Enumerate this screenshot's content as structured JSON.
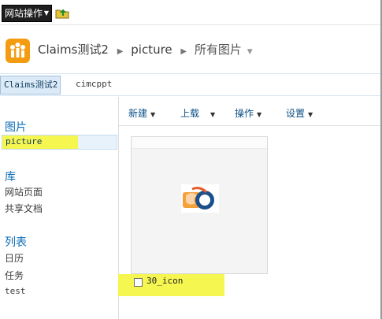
{
  "topbar": {
    "site_actions_label": "网站操作",
    "nav_up_icon": "folder-up-icon"
  },
  "header": {
    "logo_icon": "people-logo-icon",
    "breadcrumb": {
      "site": "Claims测试2",
      "library": "picture",
      "view": "所有图片"
    }
  },
  "top_nav": {
    "tabs": [
      {
        "label": "Claims测试2",
        "selected": true
      },
      {
        "label": "cimcppt",
        "selected": false
      }
    ]
  },
  "quick_launch": {
    "sections": [
      {
        "heading": "图片",
        "items": [
          "picture"
        ]
      },
      {
        "heading": "库",
        "items": [
          "网站页面",
          "共享文档"
        ]
      },
      {
        "heading": "列表",
        "items": [
          "日历",
          "任务",
          "test"
        ]
      }
    ]
  },
  "toolbar": {
    "new_label": "新建",
    "upload_label": "上载",
    "actions_label": "操作",
    "settings_label": "设置"
  },
  "content": {
    "files": [
      {
        "name": "30_icon",
        "checked": false,
        "thumbnail_icon": "30-logo-image"
      }
    ]
  },
  "colors": {
    "highlight": "#f6f650",
    "accent": "#0a6db5",
    "logo": "#f39c12"
  }
}
